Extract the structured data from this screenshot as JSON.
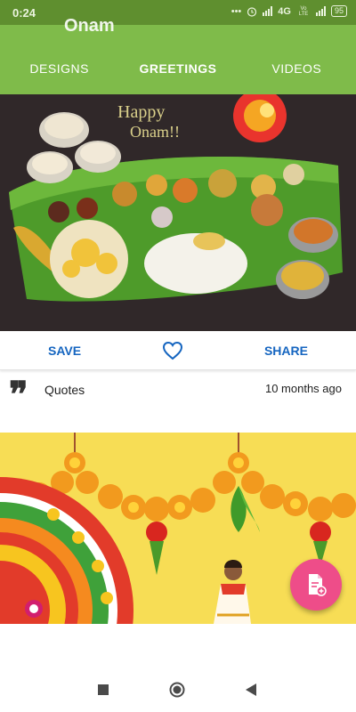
{
  "status_bar": {
    "time": "0:24",
    "network": "4G",
    "carrier_small": "Vo LTE",
    "battery": "95"
  },
  "app_bar": {
    "title": "Onam",
    "color": "#7fbb4a",
    "tabs": [
      {
        "label": "DESIGNS",
        "active": false
      },
      {
        "label": "GREETINGS",
        "active": true
      },
      {
        "label": "VIDEOS",
        "active": false
      }
    ],
    "indicator_color": "#e0207a"
  },
  "card": {
    "image_text_line1": "Happy",
    "image_text_line2": "Onam!!",
    "actions": {
      "save_label": "SAVE",
      "share_label": "SHARE",
      "like_icon": "heart-outline-icon"
    },
    "category_icon": "quote-icon",
    "category": "Quotes",
    "timestamp": "10 months ago"
  },
  "fab": {
    "icon": "document-add-icon",
    "color": "#ee4d89"
  },
  "nav": {
    "icons": [
      "recents-square-icon",
      "home-circle-icon",
      "back-triangle-icon"
    ]
  }
}
